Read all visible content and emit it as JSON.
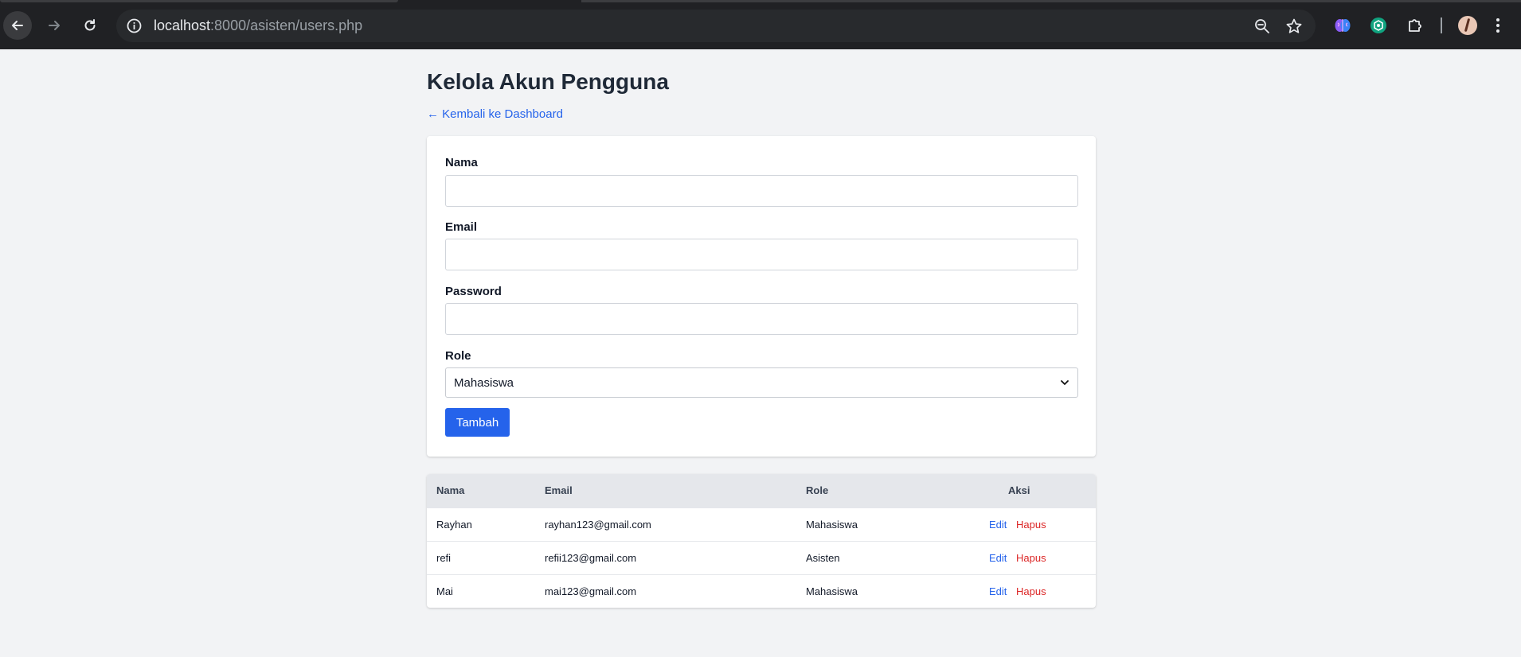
{
  "browser": {
    "url_host": "localhost",
    "url_path": ":8000/asisten/users.php"
  },
  "page": {
    "title": "Kelola Akun Pengguna",
    "back_link": "← Kembali ke Dashboard"
  },
  "form": {
    "fields": [
      {
        "label": "Nama",
        "value": ""
      },
      {
        "label": "Email",
        "value": ""
      },
      {
        "label": "Password",
        "value": ""
      }
    ],
    "role_label": "Role",
    "role_selected": "Mahasiswa",
    "submit_label": "Tambah"
  },
  "table": {
    "headers": [
      "Nama",
      "Email",
      "Role",
      "Aksi"
    ],
    "rows": [
      {
        "nama": "Rayhan",
        "email": "rayhan123@gmail.com",
        "role": "Mahasiswa",
        "edit": "Edit",
        "hapus": "Hapus"
      },
      {
        "nama": "refi",
        "email": "refii123@gmail.com",
        "role": "Asisten",
        "edit": "Edit",
        "hapus": "Hapus"
      },
      {
        "nama": "Mai",
        "email": "mai123@gmail.com",
        "role": "Mahasiswa",
        "edit": "Edit",
        "hapus": "Hapus"
      }
    ]
  },
  "colors": {
    "primary": "#2563eb",
    "danger": "#dc2626",
    "background": "#f2f3f5"
  }
}
